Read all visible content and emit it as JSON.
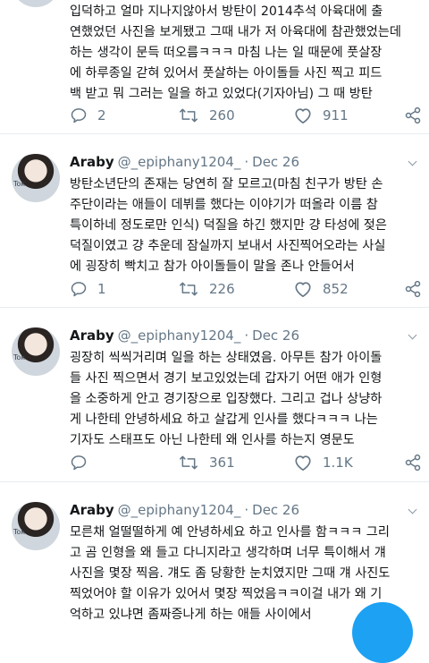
{
  "tweets": [
    {
      "lines": [
        "입덕하고 얼마 지나지않아서 방탄이 2014추석 아육대에 출",
        "연했었던 사진을 보게됐고 그때 내가 저 아육대에 참관했었는데",
        "하는 생각이 문득 떠오름ㅋㅋㅋ 마침 나는 일 때문에 풋살장",
        "에 하루종일 갇혀 있어서 풋살하는 아이돌들 사진 찍고 피드",
        "백 받고 뭐 그러는 일을 하고 있었다(기자아님) 그 때 방탄"
      ],
      "replies": "2",
      "retweets": "260",
      "likes": "911"
    },
    {
      "author": "Araby",
      "handle": "@_epiphany1204_",
      "date": "Dec 26",
      "lines": [
        "방탄소년단의 존재는 당연히 잘 모르고(마침 친구가 방탄 손",
        "주단이라는 애들이 데뷔를 했다는 이야기가 떠올라 이름 참",
        "특이하네 정도로만 인식) 덕질을 하긴 했지만 걍 타성에 젖은",
        "덕질이였고 걍 추운데 잠실까지 보내서 사진찍어오라는 사실",
        "에 굉장히 빡치고 참가 아이돌들이 말을 존나 안들어서"
      ],
      "replies": "1",
      "retweets": "226",
      "likes": "852"
    },
    {
      "author": "Araby",
      "handle": "@_epiphany1204_",
      "date": "Dec 26",
      "lines": [
        "굉장히 씩씩거리며 일을 하는 상태였음. 아무튼 참가 아이돌",
        "들 사진 찍으면서 경기 보고있었는데 갑자기 어떤 애가 인형",
        "을 소중하게 안고 경기장으로 입장했다. 그리고 겁나 상냥하",
        "게 나한테 안녕하세요 하고 살갑게 인사를 했다ㅋㅋㅋ 나는",
        "기자도 스태프도 아닌 나한테 왜 인사를 하는지 영문도"
      ],
      "replies": "",
      "retweets": "361",
      "likes": "1.1K"
    },
    {
      "author": "Araby",
      "handle": "@_epiphany1204_",
      "date": "Dec 26",
      "lines": [
        "모른채 얼떨떨하게 예 안녕하세요 하고 인사를 함ㅋㅋㅋ 그리",
        "고 곰 인형을 왜 들고 다니지라고 생각하며 너무 특이해서 걔",
        "사진을 몇장 찍음. 걔도 좀 당황한 눈치였지만 그때 걔 사진도",
        "찍었어야 할 이유가 있어서 몇장 찍었음ㅋㅋ이걸 내가 왜 기",
        "억하고 있냐면 좀짜증나게 하는 애들 사이에서"
      ]
    }
  ],
  "avatar_badge": "Tok",
  "colors": {
    "accent": "#1da1f2",
    "muted": "#657786",
    "text": "#14171a",
    "divider": "#e6ecf0"
  }
}
